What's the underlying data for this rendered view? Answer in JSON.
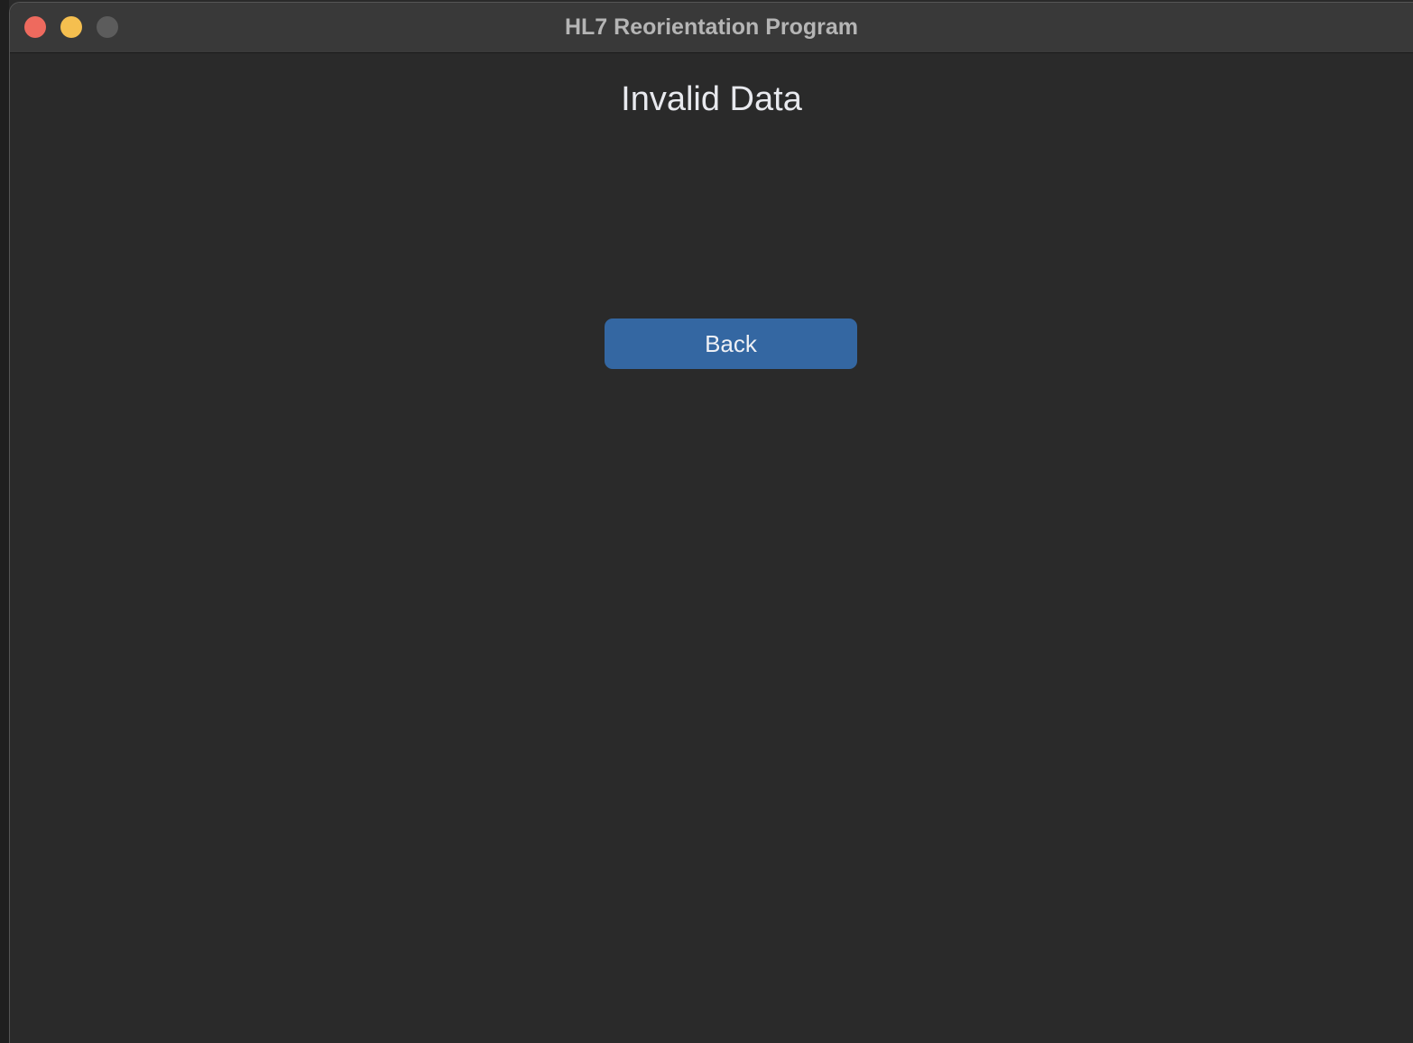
{
  "window": {
    "title": "HL7 Reorientation Program",
    "controls": {
      "close_color": "#ee6a5e",
      "minimize_color": "#f5bf4f",
      "zoom_color": "#5c5c5c"
    }
  },
  "main": {
    "heading": "Invalid Data",
    "back_label": "Back"
  },
  "colors": {
    "background": "#2a2a2a",
    "titlebar": "#393939",
    "button": "#3467a2",
    "text": "#e8e9ee"
  }
}
